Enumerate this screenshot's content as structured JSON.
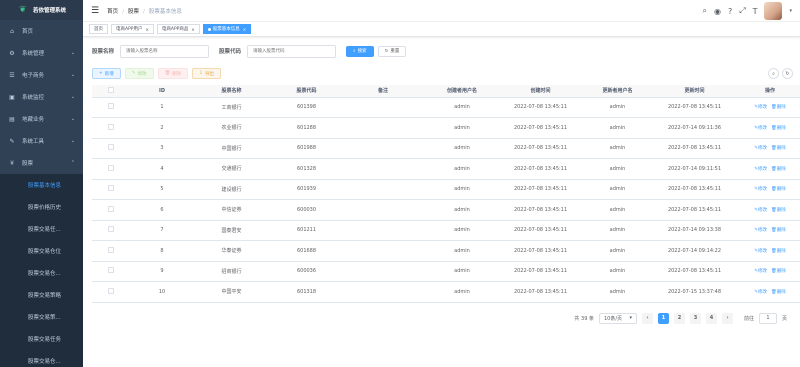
{
  "app": {
    "title": "若依管理系统"
  },
  "sidebar": {
    "items": [
      {
        "label": "首页",
        "icon": "dashboard-icon",
        "glyph": "⌂"
      },
      {
        "label": "系统管理",
        "icon": "system-icon",
        "glyph": "⚙"
      },
      {
        "label": "电子商务",
        "icon": "shop-icon",
        "glyph": "☰"
      },
      {
        "label": "系统监控",
        "icon": "monitor-icon",
        "glyph": "▣"
      },
      {
        "label": "地藏业务",
        "icon": "business-icon",
        "glyph": "▤"
      },
      {
        "label": "系统工具",
        "icon": "tool-icon",
        "glyph": "✎"
      },
      {
        "label": "股票",
        "icon": "yen-icon",
        "glyph": "¥"
      }
    ],
    "subitems": [
      "股票基本信息",
      "股票价格历史",
      "股票交易任...",
      "股票交易仓位",
      "股票交易仓...",
      "股票交易策略",
      "股票交易策...",
      "股票交易任务",
      "股票交易仓..."
    ]
  },
  "navbar": {
    "breadcrumb": [
      "首页",
      "股票",
      "股票基本信息"
    ]
  },
  "tags": [
    "首页",
    "电商APP用户",
    "电商APP商品",
    "股票基本信息"
  ],
  "search": {
    "name_label": "股票名称",
    "name_placeholder": "请输入股票名称",
    "code_label": "股票代码",
    "code_placeholder": "请输入股票代码",
    "search_btn": "搜索",
    "reset_btn": "重置"
  },
  "toolbar": {
    "add": "新增",
    "edit": "修改",
    "delete": "删除",
    "export": "导出"
  },
  "table": {
    "headers": [
      "ID",
      "股票名称",
      "股票代码",
      "备注",
      "创建者用户名",
      "创建时间",
      "更新者用户名",
      "更新时间",
      "操作"
    ],
    "rows": [
      [
        "1",
        "工商银行",
        "601398",
        "",
        "admin",
        "2022-07-08 13:45:11",
        "admin",
        "2022-07-08 13:45:11"
      ],
      [
        "2",
        "农业银行",
        "601288",
        "",
        "admin",
        "2022-07-08 13:45:11",
        "admin",
        "2022-07-14 09:11:36"
      ],
      [
        "3",
        "中国银行",
        "601988",
        "",
        "admin",
        "2022-07-08 13:45:11",
        "admin",
        "2022-07-08 13:45:11"
      ],
      [
        "4",
        "交通银行",
        "601328",
        "",
        "admin",
        "2022-07-08 13:45:11",
        "admin",
        "2022-07-14 09:11:51"
      ],
      [
        "5",
        "建设银行",
        "601939",
        "",
        "admin",
        "2022-07-08 13:45:11",
        "admin",
        "2022-07-08 13:45:11"
      ],
      [
        "6",
        "中信证券",
        "600030",
        "",
        "admin",
        "2022-07-08 13:45:11",
        "admin",
        "2022-07-08 13:45:11"
      ],
      [
        "7",
        "国泰君安",
        "601211",
        "",
        "admin",
        "2022-07-08 13:45:11",
        "admin",
        "2022-07-14 09:13:38"
      ],
      [
        "8",
        "华泰证券",
        "601688",
        "",
        "admin",
        "2022-07-08 13:45:11",
        "admin",
        "2022-07-14 09:14:22"
      ],
      [
        "9",
        "招商银行",
        "600036",
        "",
        "admin",
        "2022-07-08 13:45:11",
        "admin",
        "2022-07-08 13:45:11"
      ],
      [
        "10",
        "中国平安",
        "601318",
        "",
        "admin",
        "2022-07-08 13:45:11",
        "admin",
        "2022-07-15 13:37:48"
      ]
    ],
    "op_edit": "修改",
    "op_delete": "删除"
  },
  "pagination": {
    "total": "共 39 条",
    "page_size": "10条/页",
    "pages": [
      "1",
      "2",
      "3",
      "4"
    ],
    "goto": "前往",
    "current": "1",
    "page_unit": "页"
  },
  "colors": {
    "sidebar_bg": "#304156",
    "accent": "#409eff"
  }
}
